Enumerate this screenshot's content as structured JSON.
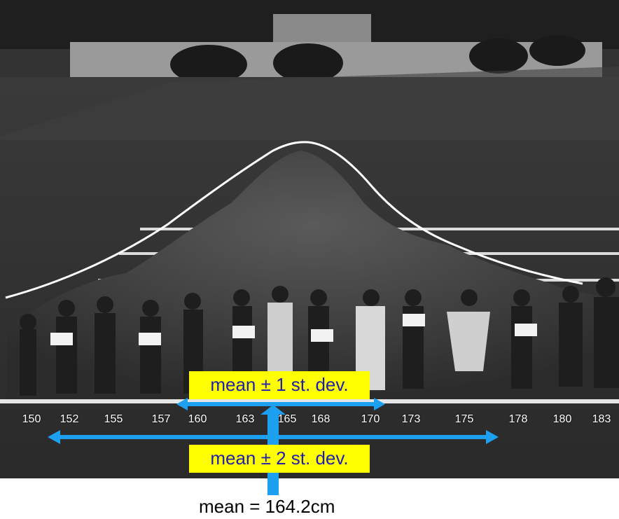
{
  "annotations": {
    "one_sd_label": "mean ± 1 st. dev.",
    "two_sd_label": "mean ± 2 st. dev.",
    "mean_label": "mean = 164.2cm"
  },
  "ticks": [
    "150",
    "152",
    "155",
    "157",
    "160",
    "163",
    "165",
    "168",
    "170",
    "173",
    "175",
    "178",
    "180",
    "183"
  ],
  "colors": {
    "grass": "#2b2b2b",
    "curve": "#ffffff",
    "arrow": "#1ea0f0",
    "label_bg": "#ffff00",
    "label_text": "#1f1fb0"
  }
}
